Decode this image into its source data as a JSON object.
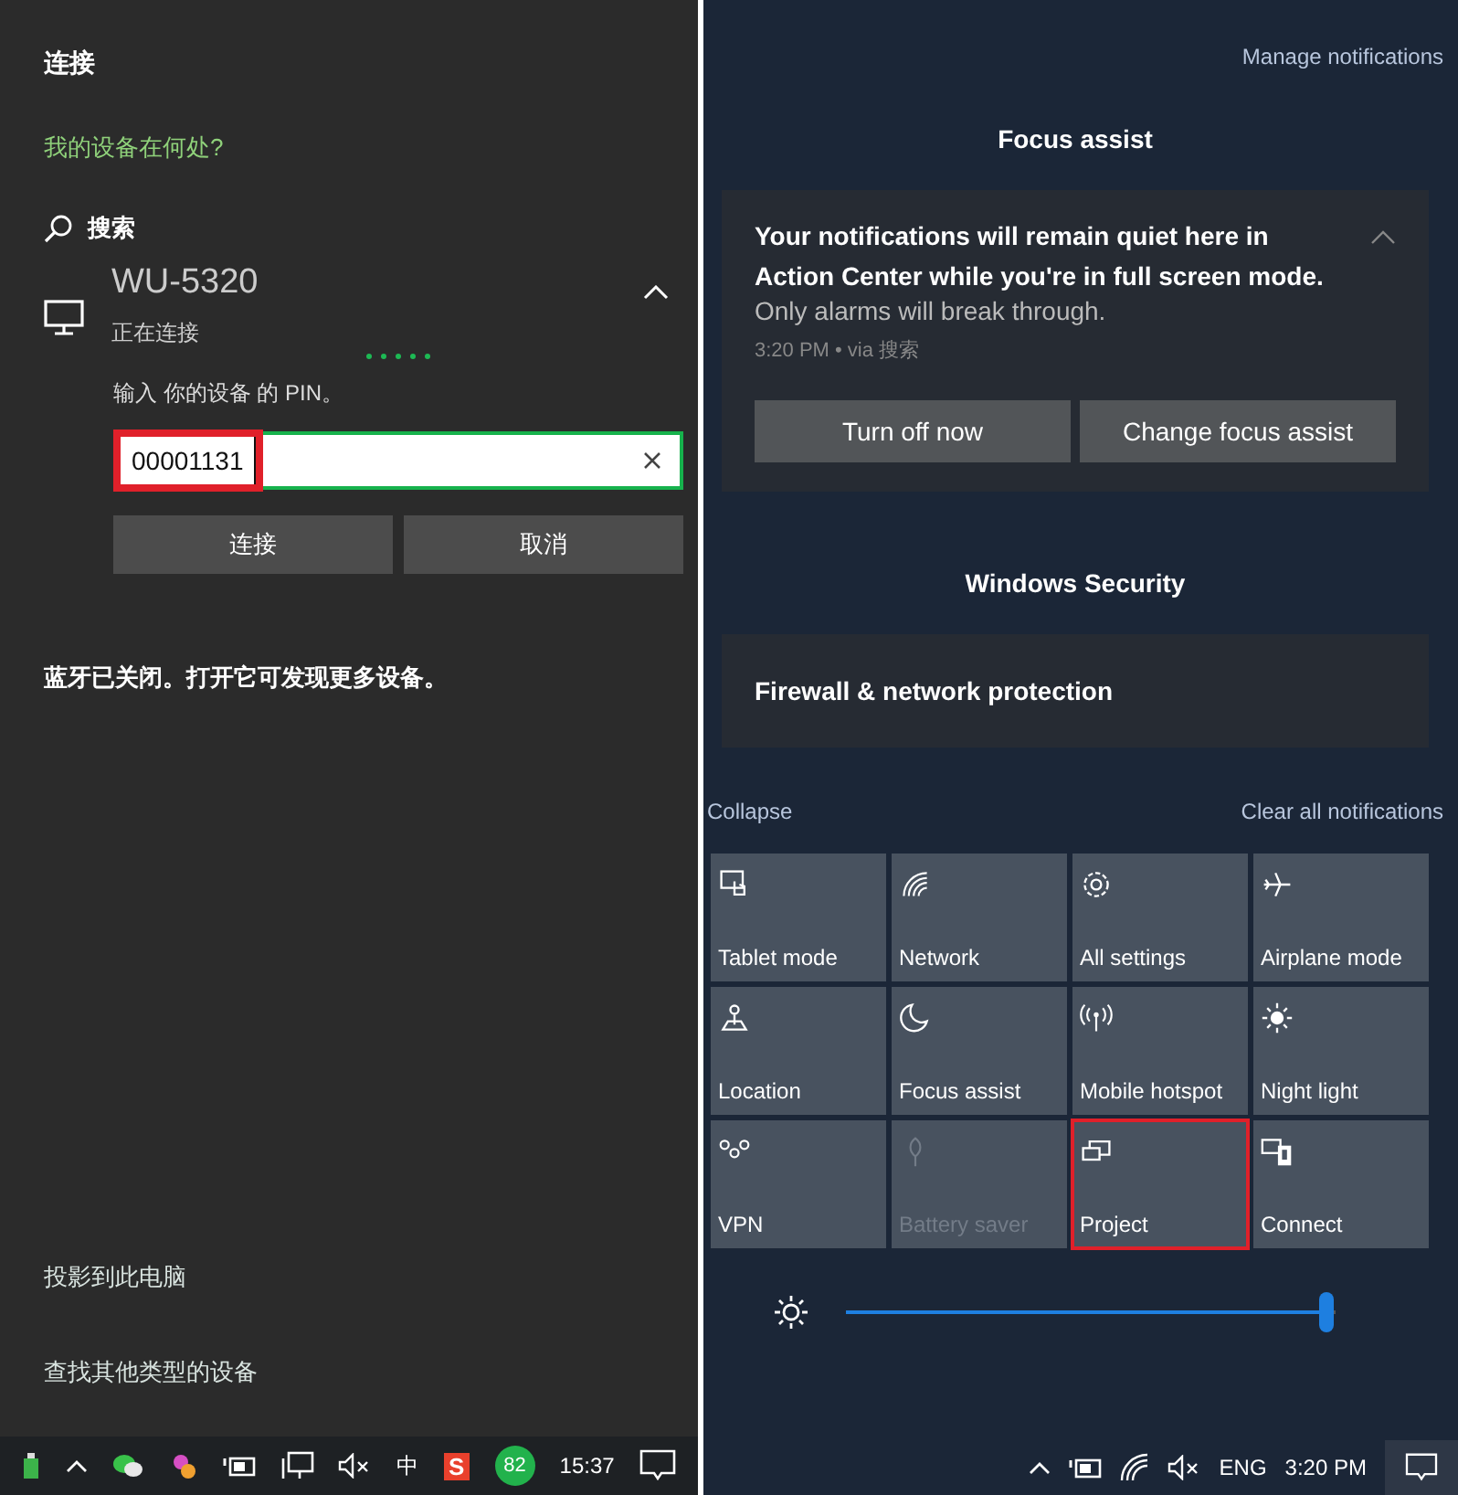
{
  "connect_panel": {
    "title": "连接",
    "where_link": "我的设备在何处?",
    "search_label": "搜索",
    "device": {
      "name": "WU-5320",
      "status": "正在连接",
      "expanded": true,
      "pin_prompt": "输入 你的设备 的 PIN。",
      "pin_field": {
        "value": "00001131",
        "highlighted": true
      },
      "buttons": [
        "连接",
        "取消"
      ]
    },
    "bluetooth_message": "蓝牙已关闭。打开它可发现更多设备。",
    "links": [
      "投影到此电脑",
      "查找其他类型的设备"
    ]
  },
  "taskbar_left": {
    "ime": "中",
    "app_badge": "S",
    "score_badge": "82",
    "clock": "15:37"
  },
  "action_center": {
    "manage_link": "Manage notifications",
    "groups": [
      {
        "header": "Focus assist",
        "notifications": [
          {
            "title": "Your notifications will remain quiet here in Action Center while you're in full screen mode.",
            "body": "Only alarms will break through.",
            "meta": "3:20 PM • via 搜索",
            "expanded": true,
            "buttons": [
              "Turn off now",
              "Change focus assist"
            ]
          }
        ]
      },
      {
        "header": "Windows Security",
        "notifications": [
          {
            "title": "Firewall & network protection"
          }
        ]
      }
    ],
    "collapse": "Collapse",
    "clear_all": "Clear all notifications",
    "tiles": [
      {
        "label": "Tablet mode",
        "disabled": false,
        "highlighted": false
      },
      {
        "label": "Network",
        "disabled": false,
        "highlighted": false
      },
      {
        "label": "All settings",
        "disabled": false,
        "highlighted": false
      },
      {
        "label": "Airplane mode",
        "disabled": false,
        "highlighted": false
      },
      {
        "label": "Location",
        "disabled": false,
        "highlighted": false
      },
      {
        "label": "Focus assist",
        "disabled": false,
        "highlighted": false
      },
      {
        "label": "Mobile hotspot",
        "disabled": false,
        "highlighted": false
      },
      {
        "label": "Night light",
        "disabled": false,
        "highlighted": false
      },
      {
        "label": "VPN",
        "disabled": false,
        "highlighted": false
      },
      {
        "label": "Battery saver",
        "disabled": true,
        "highlighted": false
      },
      {
        "label": "Project",
        "disabled": false,
        "highlighted": true
      },
      {
        "label": "Connect",
        "disabled": false,
        "highlighted": false
      }
    ],
    "brightness": {
      "level": 0.98
    }
  },
  "taskbar_right": {
    "language": "ENG",
    "clock": "3:20 PM"
  }
}
